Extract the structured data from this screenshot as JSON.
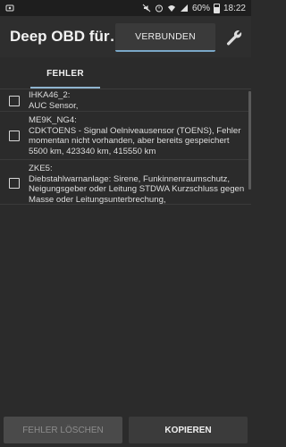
{
  "status_bar": {
    "battery": "60%",
    "time": "18:22",
    "icons": [
      "notification-icon",
      "mute-icon",
      "alarm-icon",
      "wifi-icon",
      "signal-icon",
      "battery-icon"
    ]
  },
  "app_bar": {
    "title": "Deep OBD für…",
    "connection_button": "VERBUNDEN",
    "settings_icon": "wrench-icon"
  },
  "tabs": [
    {
      "label": "FEHLER",
      "selected": true
    }
  ],
  "errors": [
    {
      "module": "IHKA46_2:",
      "text": "AUC Sensor,",
      "checked": false
    },
    {
      "module": "ME9K_NG4:",
      "text": "CDKTOENS - Signal Oelniveausensor (TOENS), Fehler momentan nicht vorhanden, aber bereits gespeichert 5500 km, 423340 km, 415550 km",
      "checked": false
    },
    {
      "module": "ZKE5:",
      "text": "Diebstahlwarnanlage: Sirene, Funkinnenraumschutz, Neigungsgeber oder Leitung STDWA Kurzschluss gegen Masse oder Leitungsunterbrechung,",
      "checked": false
    }
  ],
  "buttons": {
    "clear": "FEHLER LÖSCHEN",
    "copy": "KOPIEREN"
  },
  "colors": {
    "background": "#2b2b2b",
    "accent": "#8fb4cf"
  }
}
